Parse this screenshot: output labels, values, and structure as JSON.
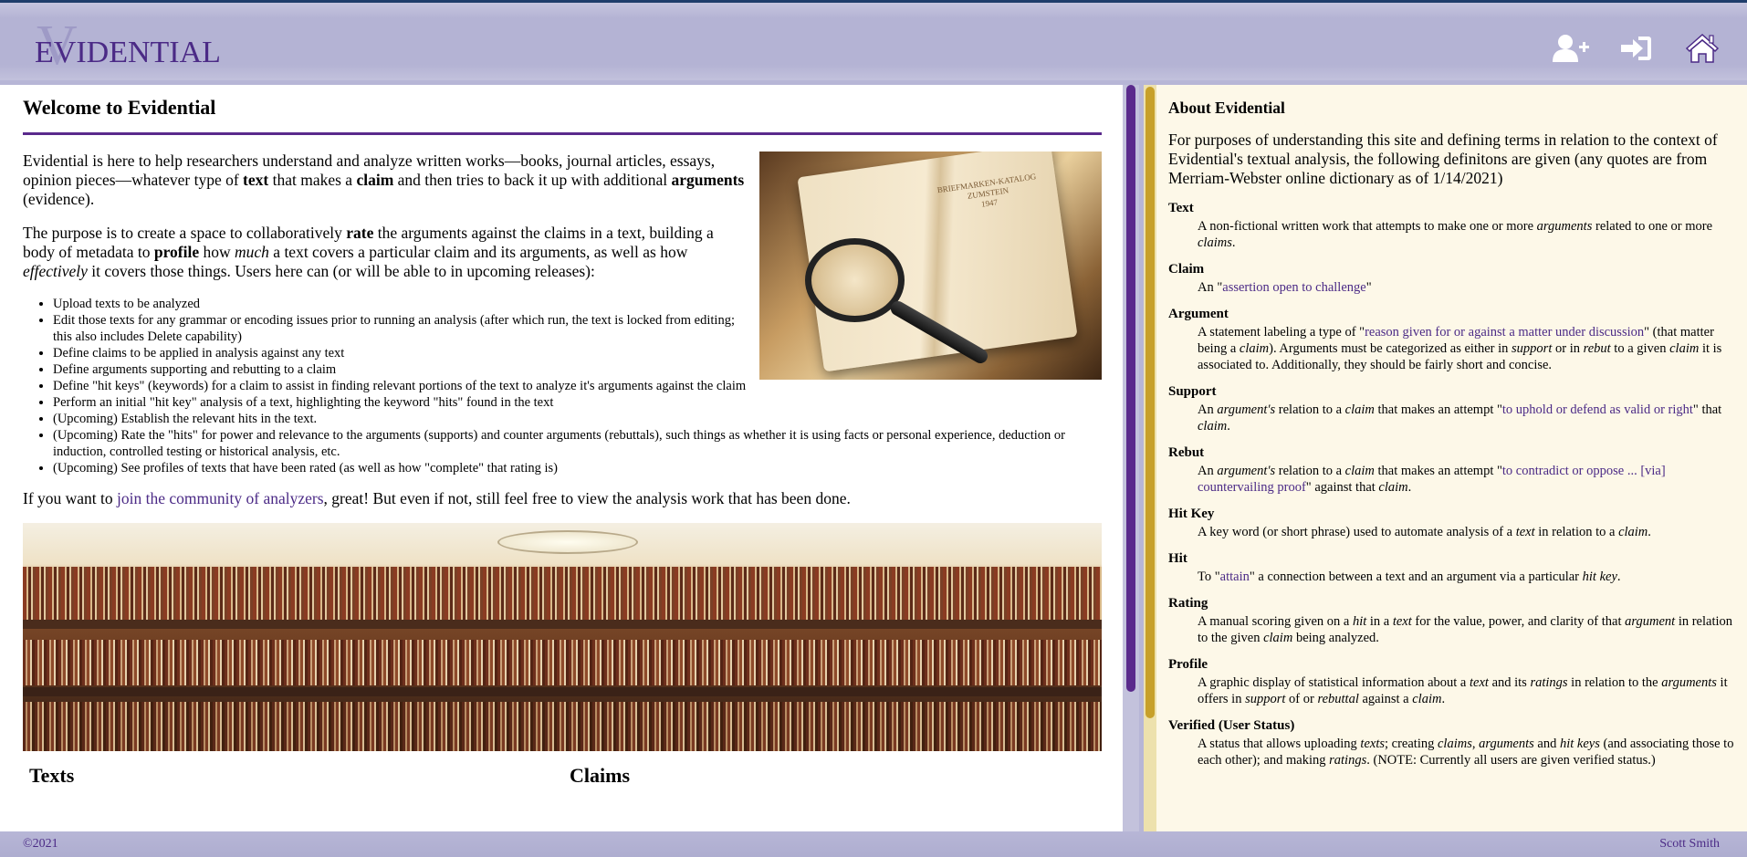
{
  "header": {
    "logo_v": "V",
    "logo_text": "EVIDENTIAL",
    "icons": [
      "add-user-icon",
      "sign-in-icon",
      "home-icon"
    ]
  },
  "main": {
    "title": "Welcome to Evidential",
    "p1": {
      "a": "Evidential is here to help researchers understand and analyze written works—books, journal articles, essays, opinion pieces—whatever type of ",
      "b1": "text",
      "c": " that makes a ",
      "b2": "claim",
      "d": " and then tries to back it up with additional ",
      "b3": "arguments",
      "e": " (evidence)."
    },
    "p2": {
      "a": "The purpose is to create a space to collaboratively ",
      "b1": "rate",
      "c": " the arguments against the claims in a text, building a body of metadata to ",
      "b2": "profile",
      "d": " how ",
      "i1": "much",
      "e": " a text covers a particular claim and its arguments, as well as how ",
      "i2": "effectively",
      "f": " it covers those things. Users here can (or will be able to in upcoming releases):"
    },
    "features": [
      "Upload texts to be analyzed",
      "Edit those texts for any grammar or encoding issues prior to running an analysis (after which run, the text is locked from editing; this also includes Delete capability)",
      "Define claims to be applied in analysis against any text",
      "Define arguments supporting and rebutting to a claim",
      "Define \"hit keys\" (keywords) for a claim to assist in finding relevant portions of the text to analyze it's arguments against the claim",
      "Perform an initial \"hit key\" analysis of a text, highlighting the keyword \"hits\" found in the text",
      "(Upcoming) Establish the relevant hits in the text.",
      "(Upcoming) Rate the \"hits\" for power and relevance to the arguments (supports) and counter arguments (rebuttals), such things as whether it is using facts or personal experience, deduction or induction, controlled testing or historical analysis, etc.",
      "(Upcoming) See profiles of texts that have been rated (as well as how \"complete\" that rating is)"
    ],
    "join": {
      "a": "If you want to ",
      "link": "join the community of analyzers",
      "b": ", great! But even if not, still feel free to view the analysis work that has been done."
    },
    "hero_book_text": "BRIEFMARKEN-KATALOG\nZUMSTEIN\n1947",
    "headings": {
      "texts": "Texts",
      "claims": "Claims"
    }
  },
  "side": {
    "title": "About Evidential",
    "intro": "For purposes of understanding this site and defining terms in relation to the context of Evidential's textual analysis, the following definitons are given (any quotes are from Merriam-Webster online dictionary as of 1/14/2021)",
    "defs": {
      "text_term": "Text",
      "text_a": "A non-fictional written work that attempts to make one or more ",
      "text_i1": "arguments",
      "text_b": " related to one or more ",
      "text_i2": "claims",
      "text_c": ".",
      "claim_term": "Claim",
      "claim_a": "An \"",
      "claim_link": "assertion open to challenge",
      "claim_b": "\"",
      "argument_term": "Argument",
      "argument_a": "A statement labeling a type of \"",
      "argument_link": "reason given for or against a matter under discussion",
      "argument_b": "\" (that matter being a ",
      "argument_i1": "claim",
      "argument_c": "). Arguments must be categorized as either in ",
      "argument_i2": "support",
      "argument_d": " or in ",
      "argument_i3": "rebut",
      "argument_e": " to a given ",
      "argument_i4": "claim",
      "argument_f": " it is associated to. Additionally, they should be fairly short and concise.",
      "support_term": "Support",
      "support_a": "An ",
      "support_i1": "argument's",
      "support_b": " relation to a ",
      "support_i2": "claim",
      "support_c": " that makes an attempt \"",
      "support_link": "to uphold or defend as valid or right",
      "support_d": "\" that ",
      "support_i3": "claim",
      "support_e": ".",
      "rebut_term": "Rebut",
      "rebut_a": "An ",
      "rebut_i1": "argument's",
      "rebut_b": " relation to a ",
      "rebut_i2": "claim",
      "rebut_c": " that makes an attempt \"",
      "rebut_link": "to contradict or oppose ... [via] countervailing proof",
      "rebut_d": "\" against that ",
      "rebut_i3": "claim",
      "rebut_e": ".",
      "hitkey_term": "Hit Key",
      "hitkey_a": "A key word (or short phrase) used to automate analysis of a ",
      "hitkey_i1": "text",
      "hitkey_b": " in relation to a ",
      "hitkey_i2": "claim",
      "hitkey_c": ".",
      "hit_term": "Hit",
      "hit_a": "To \"",
      "hit_link": "attain",
      "hit_b": "\" a connection between a text and an argument via a particular ",
      "hit_i1": "hit key",
      "hit_c": ".",
      "rating_term": "Rating",
      "rating_a": "A manual scoring given on a ",
      "rating_i1": "hit",
      "rating_b": " in a ",
      "rating_i2": "text",
      "rating_c": " for the value, power, and clarity of that ",
      "rating_i3": "argument",
      "rating_d": " in relation to the given ",
      "rating_i4": "claim",
      "rating_e": " being analyzed.",
      "profile_term": "Profile",
      "profile_a": "A graphic display of statistical information about a ",
      "profile_i1": "text",
      "profile_b": " and its ",
      "profile_i2": "ratings",
      "profile_c": " in relation to the ",
      "profile_i3": "arguments",
      "profile_d": " it offers in ",
      "profile_i4": "support",
      "profile_e": " of or ",
      "profile_i5": "rebuttal",
      "profile_f": " against a ",
      "profile_i6": "claim",
      "profile_g": ".",
      "verified_term": "Verified (User Status)",
      "verified_a": "A status that allows uploading ",
      "verified_i1": "texts",
      "verified_b": "; creating ",
      "verified_i2": "claims",
      "verified_c": ", ",
      "verified_i3": "arguments",
      "verified_d": " and ",
      "verified_i4": "hit keys",
      "verified_e": " (and associating those to each other); and making ",
      "verified_i5": "ratings",
      "verified_f": ". (NOTE: Currently all users are given verified status.)"
    }
  },
  "footer": {
    "copyright": "©2021",
    "author": "Scott Smith"
  },
  "colors": {
    "accent": "#5a2a8c",
    "header_bg": "#b4b3d4",
    "side_bg": "#fdf8e8",
    "side_scroll": "#c7a02a",
    "link": "#4b2a86"
  }
}
